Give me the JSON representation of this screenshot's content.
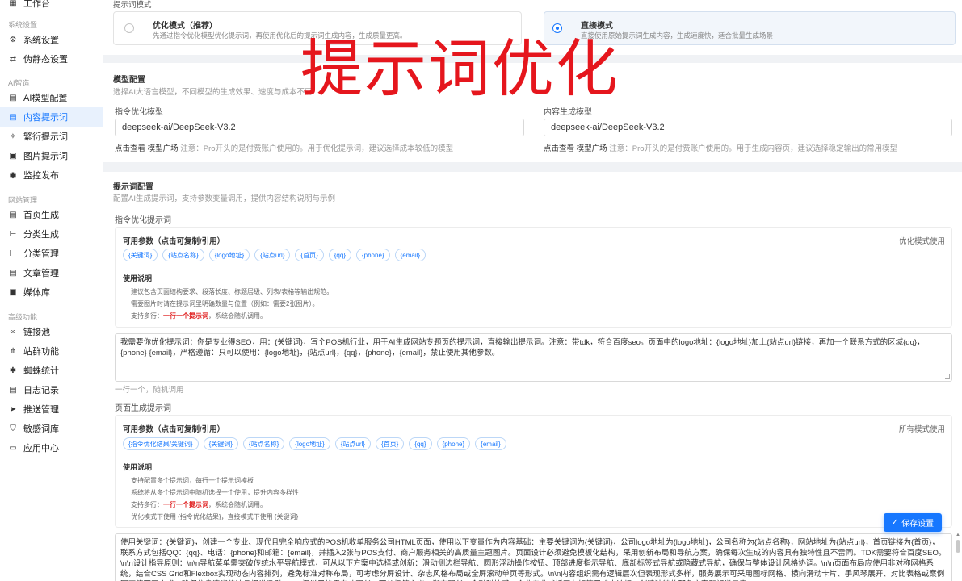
{
  "sidebar": {
    "top_item": "工作台",
    "sections": [
      {
        "title": "系统设置"
      },
      {
        "title": "AI智造"
      },
      {
        "title": "网站管理"
      },
      {
        "title": "高级功能"
      }
    ],
    "items": [
      {
        "label": "系统设置",
        "icon": "gear-icon"
      },
      {
        "label": "伪静态设置",
        "icon": "link-icon"
      },
      {
        "label": "AI模型配置",
        "icon": "document-icon"
      },
      {
        "label": "内容提示词",
        "icon": "document-icon"
      },
      {
        "label": "繁衍提示词",
        "icon": "sparkle-icon"
      },
      {
        "label": "图片提示词",
        "icon": "image-icon"
      },
      {
        "label": "监控发布",
        "icon": "eye-icon"
      },
      {
        "label": "首页生成",
        "icon": "document-icon"
      },
      {
        "label": "分类生成",
        "icon": "tree-icon"
      },
      {
        "label": "分类管理",
        "icon": "tree-icon"
      },
      {
        "label": "文章管理",
        "icon": "document-icon"
      },
      {
        "label": "媒体库",
        "icon": "image-icon"
      },
      {
        "label": "链接池",
        "icon": "chain-icon"
      },
      {
        "label": "站群功能",
        "icon": "network-icon"
      },
      {
        "label": "蜘蛛统计",
        "icon": "spider-icon"
      },
      {
        "label": "日志记录",
        "icon": "document-icon"
      },
      {
        "label": "推送管理",
        "icon": "send-icon"
      },
      {
        "label": "敏感词库",
        "icon": "shield-icon"
      },
      {
        "label": "应用中心",
        "icon": "app-icon"
      }
    ]
  },
  "mode": {
    "title": "提示词模式",
    "options": [
      {
        "title": "优化模式（推荐）",
        "desc": "先通过指令优化模型优化提示词，再使用优化后的提示词生成内容，生成质量更高。",
        "selected": false
      },
      {
        "title": "直接模式",
        "desc": "直接使用原始提示词生成内容，生成速度快，适合批量生成场景",
        "selected": true
      }
    ]
  },
  "overlay_text": "提示词优化",
  "model_config": {
    "title": "模型配置",
    "subtitle": "选择AI大语言模型，不同模型的生成效果、速度与成本不同",
    "instruction_model": {
      "label": "指令优化模型",
      "value": "deepseek-ai/DeepSeek-V3.2",
      "hint_link": "点击查看 模型广场",
      "hint": "注意：Pro开头的是付费账户使用的。用于优化提示词，建议选择成本较低的模型"
    },
    "content_model": {
      "label": "内容生成模型",
      "value": "deepseek-ai/DeepSeek-V3.2",
      "hint_link": "点击查看 模型广场",
      "hint": "注意：Pro开头的是付费账户使用的。用于生成内容页，建议选择稳定输出的常用模型"
    }
  },
  "prompt_config": {
    "title": "提示词配置",
    "subtitle": "配置AI生成提示词，支持参数变量调用，提供内容结构说明与示例",
    "instruction_section": {
      "label": "指令优化提示词",
      "params_title": "可用参数（点击可复制/引用）",
      "params_right": "优化模式使用",
      "chips": [
        "{关键词}",
        "{站点名称}",
        "{logo地址}",
        "{站点url}",
        "{首页}",
        "{qq}",
        "{phone}",
        "{email}"
      ],
      "usage_title": "使用说明",
      "usage_lines": [
        {
          "text": "建议包含页面结构要求、段落长度、标题层级、列表/表格等输出规范。"
        },
        {
          "text": "需要图片时请在提示词里明确数量与位置（例如：需要2张图片）。"
        },
        {
          "prefix": "支持多行：",
          "red": "一行一个提示词",
          "suffix": "，系统会随机调用。"
        }
      ],
      "textarea": "我需要你优化提示词：你是专业得SEO，用：{关键词}，写个POS机行业，用于AI生成网站专题页的提示词，直接输出提示词。注意：带tdk，符合百度seo。页面中的logo地址：{logo地址}加上{站点url}链接，再加一个联系方式的区域{qq}，{phone} {email}，严格遵循：只可以使用：{logo地址}，{站点url}，{qq}，{phone}，{email}，禁止使用其他参数。",
      "footer_hint": "一行一个，随机调用"
    },
    "page_section": {
      "label": "页面生成提示词",
      "params_title": "可用参数（点击可复制/引用）",
      "params_right": "所有模式使用",
      "chips": [
        "{指令优化结果/关键词}",
        "{关键词}",
        "{站点名称}",
        "{logo地址}",
        "{站点url}",
        "{首页}",
        "{qq}",
        "{phone}",
        "{email}"
      ],
      "usage_title": "使用说明",
      "usage_lines": [
        {
          "text": "支持配置多个提示词，每行一个提示词模板"
        },
        {
          "text": "系统将从多个提示词中随机选择一个使用，提升内容多样性"
        },
        {
          "prefix": "支持多行：",
          "red": "一行一个提示词",
          "suffix": "，系统会随机调用。"
        },
        {
          "text": "优化模式下使用 {指令优化结果}，直接模式下使用 {关键词}"
        }
      ],
      "textarea": "使用关键词：{关键词}，创建一个专业、现代且完全响应式的POS机收单服务公司HTML页面，使用以下变量作为内容基础：主要关键词为{关键词}，公司logo地址为{logo地址}，公司名称为{站点名称}，网站地址为{站点url}，首页链接为{首页}，联系方式包括QQ：{qq}、电话：{phone}和邮箱：{email}，并插入2张与POS支付、商户服务相关的高质量主题图片。页面设计必须避免模板化结构，采用创新布局和导航方案，确保每次生成的内容具有独特性且不雷同。TDK需要符合百度SEO。\\n\\n设计指导原则：\\n\\n导航菜单需突破传统水平导航模式，可从以下方案中选择或创新：滑动侧边栏导航、圆形浮动操作按钮、顶部进度指示导航、底部标签式导航或隐藏式导航，确保与整体设计风格协调。\\n\\n页面布局应使用非对称网格系统，结合CSS Grid和Flexbox实现动态内容排列，避免标准对称布局，可考虑分屏设计、杂志风格布局或全屏滚动单页等形式。\\n\\n内容组织需有逻辑层次但表现形式多样，服务展示可采用图标网格、横向滑动卡片、手风琴展开、对比表格或案例图廊等不同方式，确保信息清晰传达且视觉吸引。\\n\\n视觉风格需专业现代，可从极简主义、渐变现代、金融科技感、企业专业或插画友好等风格中选择，创建独特的配色方案和视觉元素。"
    }
  },
  "save_button": "保存设置"
}
